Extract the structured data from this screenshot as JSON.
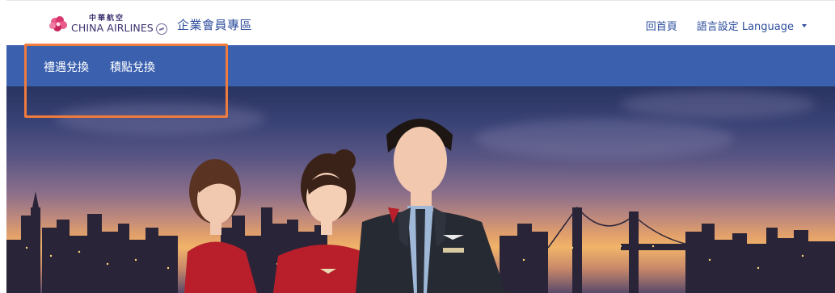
{
  "header": {
    "logo": {
      "chinese": "中華航空",
      "english": "CHINA AIRLINES"
    },
    "brand_title": "企業會員專區",
    "nav": {
      "home": "回首頁",
      "language": "語言設定 Language"
    }
  },
  "subnav": {
    "items": [
      {
        "label": "禮遇兌換"
      },
      {
        "label": "積點兌換"
      }
    ]
  },
  "colors": {
    "primary_blue": "#3a60ae",
    "link_blue": "#2e4e9c",
    "highlight_orange": "#f07b3e",
    "uniform_red": "#b81f2b"
  },
  "icons": {
    "logo": "plum-blossom-logo-icon",
    "language_caret": "caret-down-icon"
  }
}
